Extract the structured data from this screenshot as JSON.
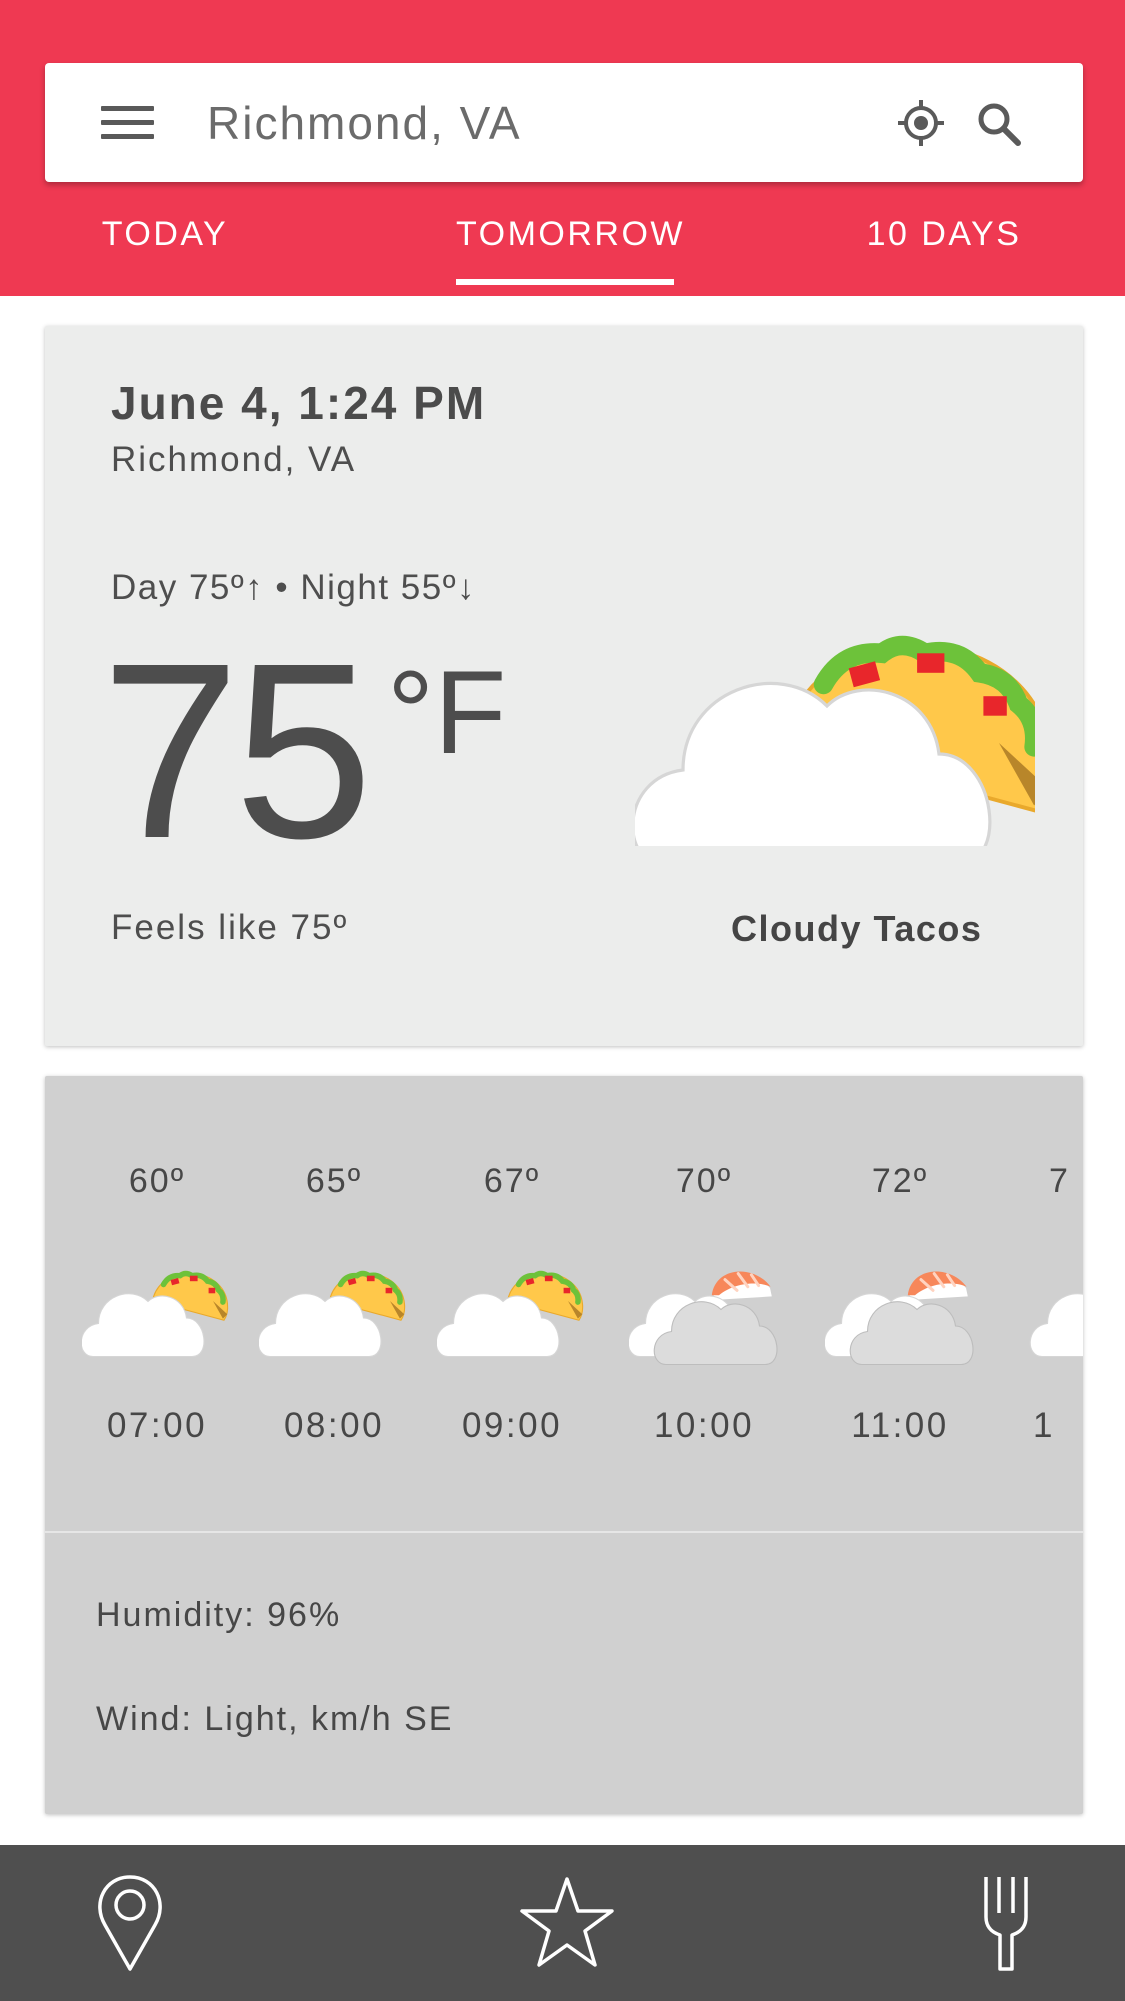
{
  "search": {
    "value": "Richmond, VA"
  },
  "tabs": [
    {
      "label": "TODAY"
    },
    {
      "label": "TOMORROW",
      "active": true
    },
    {
      "label": "10 DAYS"
    }
  ],
  "current": {
    "date": "June 4, 1:24 PM",
    "city": "Richmond, VA",
    "day_night": "Day 75º↑ • Night 55º↓",
    "temperature": "75",
    "unit": "°F",
    "feels_like": "Feels like 75º",
    "condition": "Cloudy Tacos",
    "icon": "cloudy-taco"
  },
  "hourly": [
    {
      "temp": "60º",
      "time": "07:00",
      "icon": "cloudy-taco"
    },
    {
      "temp": "65º",
      "time": "08:00",
      "icon": "cloudy-taco"
    },
    {
      "temp": "67º",
      "time": "09:00",
      "icon": "cloudy-taco"
    },
    {
      "temp": "70º",
      "time": "10:00",
      "icon": "cloudy-sushi"
    },
    {
      "temp": "72º",
      "time": "11:00",
      "icon": "cloudy-sushi"
    },
    {
      "temp": "7",
      "time": "1",
      "icon": "cloudy-taco"
    }
  ],
  "details": {
    "humidity": "Humidity: 96%",
    "wind": "Wind: Light, km/h SE"
  },
  "bottom_nav": [
    {
      "icon": "map-pin-icon"
    },
    {
      "icon": "star-icon"
    },
    {
      "icon": "fork-icon"
    }
  ],
  "colors": {
    "header": "#ef3952",
    "card": "#ecedec",
    "hourly_card": "#d0d0d0",
    "bottom_nav": "#4f4f4f"
  }
}
